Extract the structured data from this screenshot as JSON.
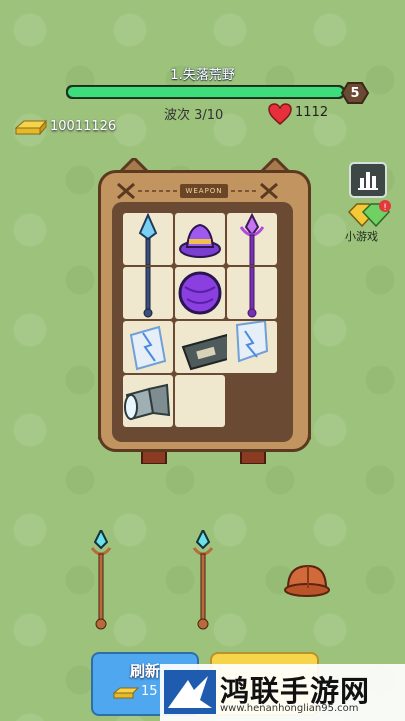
{
  "level": {
    "title": "1.失落荒野",
    "number": "5",
    "progress": 1.0
  },
  "wave": {
    "text": "波次 3/10"
  },
  "health": {
    "value": "1112"
  },
  "gold": {
    "value": "10011126"
  },
  "side_menu": {
    "minigame_label": "小游戏"
  },
  "bag": {
    "tag": "WEAPON",
    "items": [
      "crystal-spear",
      "purple-hat",
      "purple-staff",
      "purple-orb",
      "lightning-scroll",
      "bottle-bomb",
      "flashlight"
    ]
  },
  "shop": {
    "items": [
      "crystal-spear",
      "crystal-spear",
      "helmet"
    ],
    "refresh_label": "刷新",
    "refresh_cost": "15"
  },
  "watermark": {
    "title": "鸿联手游网",
    "url": "www.henanhonglian95.com"
  },
  "colors": {
    "hp_bar": "#3ddd7c",
    "refresh_button": "#4fa7ef",
    "bag": "#c2945f"
  }
}
